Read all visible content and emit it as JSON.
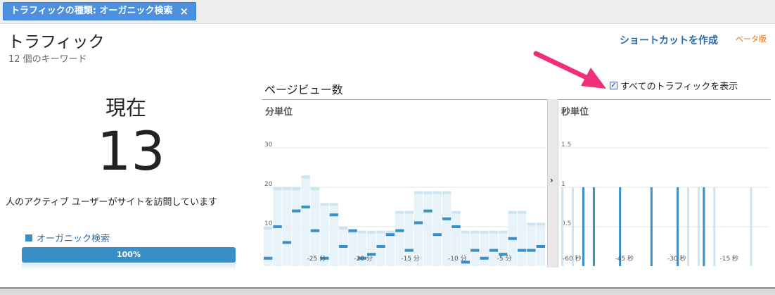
{
  "filter_chip": {
    "label": "トラフィックの種類: オーガニック検索",
    "close_icon": "×"
  },
  "header": {
    "title": "トラフィック",
    "subtitle": "12 個のキーワード",
    "shortcut_label": "ショートカットを作成",
    "beta_label": "ベータ版"
  },
  "summary": {
    "now_label": "現在",
    "active_users": "13",
    "description": "人のアクティブ ユーザーがサイトを訪問しています",
    "legend_label": "オーガニック検索",
    "progress_label": "100%",
    "progress_value": 1.0,
    "colors": {
      "accent": "#3a8fc8",
      "link": "#2a6aa8",
      "beta": "#e0701a",
      "arrow": "#f0307a"
    }
  },
  "pageviews": {
    "title": "ページビュー数",
    "show_all_label": "すべてのトラフィックを表示",
    "show_all_checked": true,
    "expand_icon": "›"
  },
  "chart_data": [
    {
      "type": "bar",
      "title": "分単位",
      "ylim": [
        0,
        30
      ],
      "y_ticks": [
        "30",
        "20",
        "10"
      ],
      "x_ticks": [
        "-25 分",
        "-20 分",
        "-15 分",
        "-10 分",
        "-5 分"
      ],
      "grid": true,
      "series": [
        {
          "name": "",
          "values": [
            2,
            10,
            6,
            14,
            15,
            9,
            2,
            13,
            5,
            9,
            2,
            3,
            5,
            8,
            9,
            4,
            11,
            14,
            8,
            12,
            10,
            1,
            4,
            2,
            4,
            3,
            7,
            4,
            4,
            5
          ]
        },
        {
          "name": "すべてのトラフィックを表示",
          "values": [
            10,
            20,
            20,
            20,
            23,
            20,
            16,
            16,
            10,
            9,
            9,
            9,
            9,
            9,
            14,
            14,
            19,
            19,
            19,
            19,
            14,
            9,
            9,
            9,
            9,
            9,
            14,
            14,
            11,
            11
          ]
        }
      ]
    },
    {
      "type": "bar",
      "title": "秒単位",
      "ylim": [
        0,
        1.5
      ],
      "y_ticks": [
        "1.5",
        "1",
        "0.5"
      ],
      "x_ticks": [
        "-60 秒",
        "-45 秒",
        "-30 秒",
        "-15 秒"
      ],
      "grid": true,
      "series": [
        {
          "name": "",
          "values": [
            0,
            0,
            0,
            0,
            1,
            0,
            1,
            0,
            0,
            0,
            0,
            1,
            0,
            0,
            0,
            0,
            0,
            1,
            0,
            0,
            0,
            0,
            1,
            0,
            0,
            0,
            0,
            1,
            0,
            0,
            0,
            0,
            0,
            0,
            0,
            0,
            0,
            0,
            0,
            0
          ]
        },
        {
          "name": "すべてのトラフィックを表示",
          "values": [
            1,
            0,
            1,
            0,
            1,
            0,
            1,
            0,
            0,
            0,
            0,
            1,
            0,
            0,
            0,
            0,
            0,
            1,
            0,
            0,
            0,
            0,
            1,
            0,
            1,
            0,
            1,
            1,
            0,
            1,
            0,
            0,
            0,
            0,
            0,
            0,
            1,
            0,
            0,
            0
          ]
        }
      ]
    }
  ]
}
